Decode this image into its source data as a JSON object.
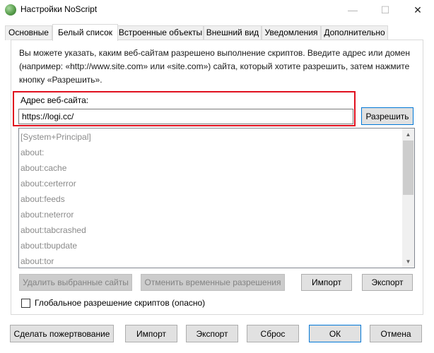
{
  "window": {
    "title": "Настройки NoScript",
    "minimize_glyph": "—",
    "maximize_glyph": "☐",
    "close_glyph": "✕"
  },
  "tabs": [
    {
      "label": "Основные",
      "active": false
    },
    {
      "label": "Белый список",
      "active": true
    },
    {
      "label": "Встроенные объекты",
      "active": false
    },
    {
      "label": "Внешний вид",
      "active": false
    },
    {
      "label": "Уведомления",
      "active": false
    },
    {
      "label": "Дополнительно",
      "active": false
    }
  ],
  "whitelist": {
    "description_lines": [
      "Вы можете указать, каким веб-сайтам разрешено выполнение скриптов. Введите адрес или домен",
      "(например: «http://www.site.com» или «site.com») сайта, который хотите разрешить, затем нажмите",
      "кнопку «Разрешить»."
    ],
    "address_label": "Адрес веб-сайта:",
    "address_value": "https://logi.cc/",
    "allow_button": "Разрешить",
    "sites": [
      "[System+Principal]",
      "about:",
      "about:cache",
      "about:certerror",
      "about:feeds",
      "about:neterror",
      "about:tabcrashed",
      "about:tbupdate",
      "about:tor"
    ],
    "remove_selected_button": "Удалить выбранные сайты",
    "revoke_temp_button": "Отменить временные разрешения",
    "import_button": "Импорт",
    "export_button": "Экспорт",
    "global_allow_label": "Глобальное разрешение скриптов (опасно)",
    "global_allow_checked": false
  },
  "footer": {
    "donate_button": "Сделать пожертвование",
    "import_button": "Импорт",
    "export_button": "Экспорт",
    "reset_button": "Сброс",
    "ok_button": "ОК",
    "cancel_button": "Отмена"
  },
  "colors": {
    "highlight_border": "#e0101e",
    "primary_border": "#0078d7",
    "disabled_text": "#838383"
  }
}
